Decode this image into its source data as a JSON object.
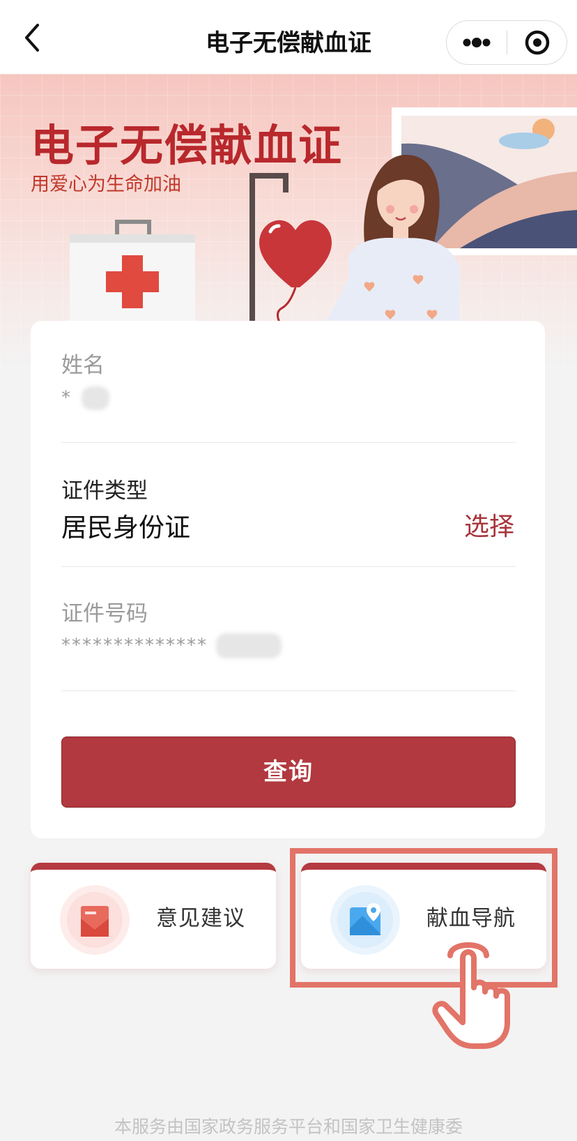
{
  "header": {
    "title": "电子无偿献血证"
  },
  "banner": {
    "title": "电子无偿献血证",
    "subtitle": "用爱心为生命加油"
  },
  "form": {
    "name": {
      "label": "姓名",
      "value": "*"
    },
    "id_type": {
      "label": "证件类型",
      "value": "居民身份证",
      "action": "选择"
    },
    "id_number": {
      "label": "证件号码",
      "value": "**************"
    },
    "submit_label": "查询"
  },
  "actions": [
    {
      "label": "意见建议",
      "icon": "envelope-icon"
    },
    {
      "label": "献血导航",
      "icon": "map-pin-icon"
    }
  ],
  "footer": {
    "text": "本服务由国家政务服务平台和国家卫生健康委"
  },
  "colors": {
    "accent": "#b1393f",
    "highlight": "#e27468"
  }
}
